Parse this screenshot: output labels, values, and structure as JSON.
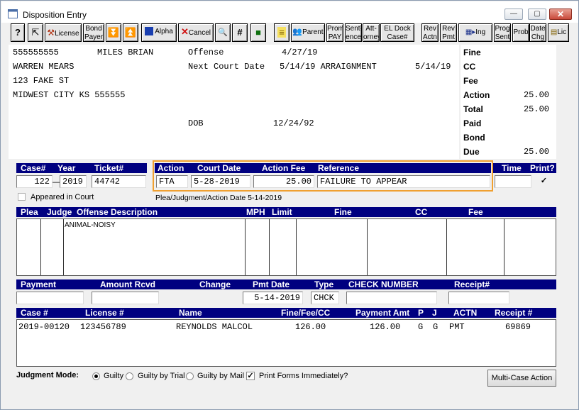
{
  "window": {
    "title": "Disposition Entry",
    "min_glyph": "—",
    "max_glyph": "▢",
    "close_glyph": "✕"
  },
  "toolbar": {
    "help": "?",
    "expand_icon": "⇱",
    "license": "License",
    "bond_payer_1": "Bond",
    "bond_payer_2": "Payer",
    "down_icon": "⏬",
    "up_icon": "⏫",
    "alpha": "Alpha",
    "cancel": "Cancel",
    "find_icon": "🔍",
    "hash": "#",
    "save_icon": "■",
    "list_icon": "≡",
    "parent": "Parent",
    "prom_pay_1": "Prom",
    "prom_pay_2": "PAY",
    "sentence_1": "Sent-",
    "sentence_2": "ence",
    "attorney_1": "Att-",
    "attorney_2": "orney",
    "el_dock_1": "EL Dock",
    "el_dock_2": "Case#",
    "rev_actn_1": "Rev",
    "rev_actn_2": "Actn",
    "rev_pmt_1": "Rev",
    "rev_pmt_2": "Pmt",
    "ing": "Ing",
    "prog_sent_1": "Prog",
    "prog_sent_2": "Sent",
    "prob": "Prob",
    "date_chg_1": "Date",
    "date_chg_2": "Chg",
    "lic": "Lic"
  },
  "info": {
    "line1_id": "555555555",
    "line1_name": "MILES BRIAN",
    "offense_label": "Offense",
    "offense_date": "4/27/19",
    "line2": "WARREN MEARS",
    "next_court_label": "Next Court Date",
    "next_court_value": "5/14/19 ARRAIGNMENT",
    "next_court_date2": "5/14/19",
    "line3": "123 FAKE ST",
    "line4": "MIDWEST CITY KS 555555",
    "dob_label": "DOB",
    "dob_value": "12/24/92"
  },
  "totals": {
    "fine_label": "Fine",
    "cc_label": "CC",
    "fee_label": "Fee",
    "action_label": "Action",
    "action_value": "25.00",
    "total_label": "Total",
    "total_value": "25.00",
    "paid_label": "Paid",
    "bond_label": "Bond",
    "due_label": "Due",
    "due_value": "25.00"
  },
  "case_header": {
    "case": "Case#",
    "year": "Year",
    "ticket": "Ticket#",
    "action": "Action",
    "court_date": "Court Date",
    "action_fee": "Action Fee",
    "reference": "Reference",
    "time": "Time",
    "print": "Print?"
  },
  "case_row": {
    "case_no": "122",
    "year": "2019",
    "ticket": "44742",
    "action": "FTA",
    "court_date": "5-28-2019",
    "action_fee": "25.00",
    "reference": "FAILURE TO APPEAR",
    "time": "",
    "print_checked": "✓"
  },
  "appeared_label": "Appeared in Court",
  "plea_action_date": "Plea/Judgment/Action Date 5-14-2019",
  "plea_header": {
    "plea": "Plea",
    "judge": "Judge",
    "offense_desc": "Offense Description",
    "mph": "MPH",
    "limit": "Limit",
    "fine": "Fine",
    "cc": "CC",
    "fee": "Fee"
  },
  "plea_row": {
    "offense_desc": "ANIMAL-NOISY"
  },
  "payment_header": {
    "payment": "Payment",
    "amount_rcvd": "Amount Rcvd",
    "change": "Change",
    "pmt_date": "Pmt Date",
    "type": "Type",
    "check_number": "CHECK NUMBER",
    "receipt": "Receipt#"
  },
  "payment_row": {
    "payment": "",
    "amount_rcvd": "",
    "pmt_date": "5-14-2019",
    "type": "CHCK",
    "check_number": "",
    "receipt": ""
  },
  "history_header": {
    "case": "Case #",
    "license": "License #",
    "name": "Name",
    "fine_fee_cc": "Fine/Fee/CC",
    "payment_amt": "Payment Amt",
    "p": "P",
    "j": "J",
    "actn": "ACTN",
    "receipt": "Receipt #"
  },
  "history_rows": [
    {
      "case": "2019-00120",
      "license": "123456789",
      "name": "REYNOLDS MALCOL",
      "fine_fee_cc": "126.00",
      "payment_amt": "126.00",
      "p": "G",
      "j": "G",
      "actn": "PMT",
      "receipt": "69869"
    }
  ],
  "judgment": {
    "label": "Judgment Mode:",
    "guilty": "Guilty",
    "guilty_by_trial": "Guilty by Trial",
    "guilty_by_mail": "Guilty by Mail",
    "print_forms": "Print Forms Immediately?",
    "print_forms_checked": "✓"
  },
  "multi_case_button": "Multi-Case Action",
  "colors": {
    "header_bar": "#000080",
    "highlight_box": "#f0a030"
  }
}
